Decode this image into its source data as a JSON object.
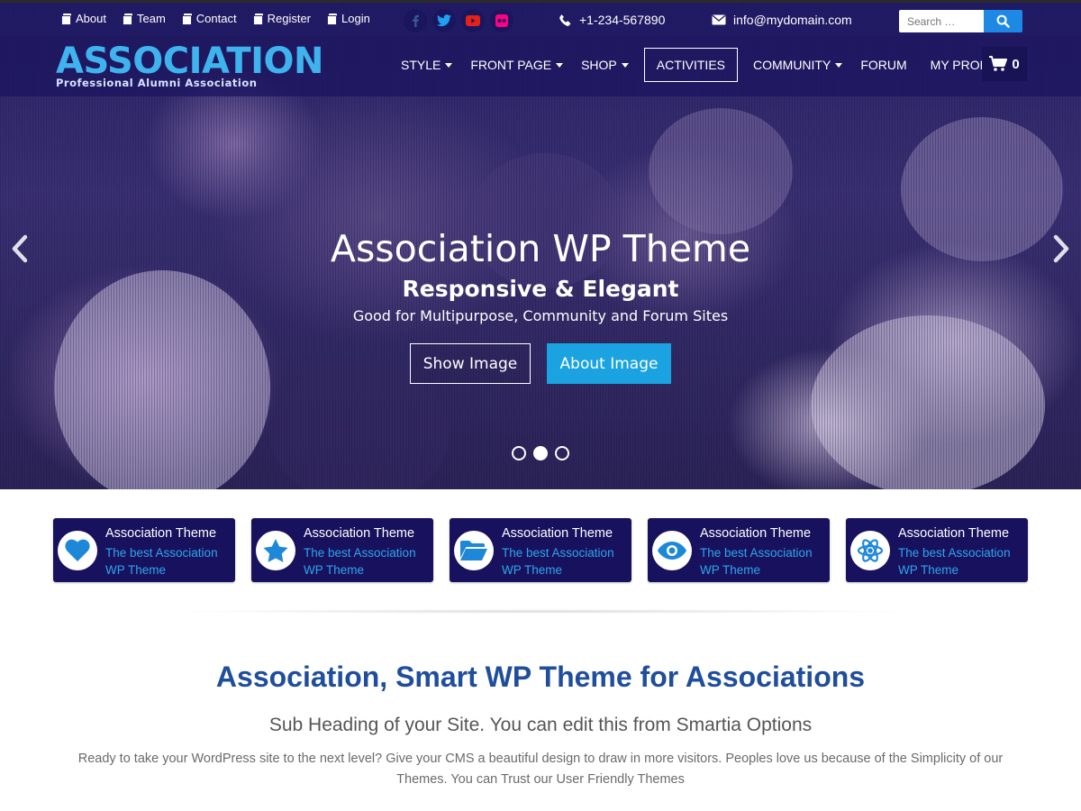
{
  "topbar": {
    "links": [
      {
        "label": "About"
      },
      {
        "label": "Team"
      },
      {
        "label": "Contact"
      },
      {
        "label": "Register"
      },
      {
        "label": "Login"
      }
    ],
    "socials": [
      {
        "icon": "facebook-icon",
        "color": "#3b5998"
      },
      {
        "icon": "twitter-icon",
        "color": "#1da1f2"
      },
      {
        "icon": "youtube-icon",
        "color": "#e62117"
      },
      {
        "icon": "flickr-icon",
        "color": "#ff0084"
      }
    ],
    "phone": "+1-234-567890",
    "email": "info@mydomain.com",
    "search_placeholder": "Search …"
  },
  "logo": {
    "title": "ASSOCIATION",
    "subtitle": "Professional Alumni Association"
  },
  "menu": {
    "items": [
      {
        "label": "STYLE",
        "dropdown": true
      },
      {
        "label": "FRONT PAGE",
        "dropdown": true
      },
      {
        "label": "SHOP",
        "dropdown": true
      },
      {
        "label": "ACTIVITIES",
        "active": true
      },
      {
        "label": "COMMUNITY",
        "dropdown": true
      },
      {
        "label": "FORUM"
      },
      {
        "label": "MY PROFILE"
      }
    ],
    "cart_count": "0"
  },
  "slider": {
    "title": "Association WP Theme",
    "subtitle": "Responsive & Elegant",
    "description": "Good for Multipurpose, Community and Forum Sites",
    "button_primary": "Show Image",
    "button_secondary": "About Image",
    "slide_count": 3,
    "active_slide": 2
  },
  "features": [
    {
      "icon": "heart-icon",
      "title": "Association Theme",
      "text": "The best Association WP Theme"
    },
    {
      "icon": "star-icon",
      "title": "Association Theme",
      "text": "The best Association WP Theme"
    },
    {
      "icon": "folder-open-icon",
      "title": "Association Theme",
      "text": "The best Association WP Theme"
    },
    {
      "icon": "eye-icon",
      "title": "Association Theme",
      "text": "The best Association WP Theme"
    },
    {
      "icon": "atom-icon",
      "title": "Association Theme",
      "text": "The best Association WP Theme"
    }
  ],
  "intro": {
    "title": "Association, Smart WP Theme for Associations",
    "subtitle": "Sub Heading of your Site. You can edit this from Smartia Options",
    "body": "Ready to take your WordPress site to the next level? Give your CMS a beautiful design to draw in more visitors. Peoples love us because of the Simplicity of our Themes. You can Trust our User Friendly Themes"
  },
  "colors": {
    "brand_blue": "#3fb3ee",
    "nav_bg": "#1c1660",
    "feature_bg": "#18125e",
    "accent": "#1aa3e0",
    "heading": "#1f4e9c"
  }
}
